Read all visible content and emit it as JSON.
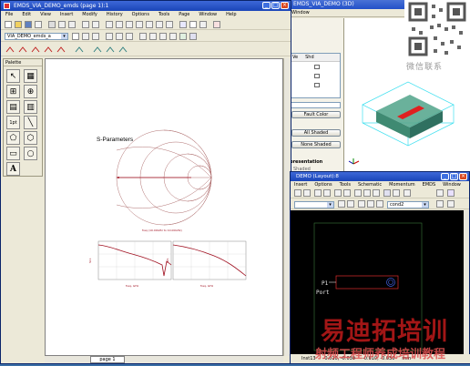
{
  "win3d": {
    "title": "EMDS_VIA_DEMO (3D)",
    "menu": "Window",
    "col_headers": [
      "Ve",
      "Shd"
    ],
    "buttons": [
      "Fault Color",
      "All Shaded",
      "None Shaded"
    ],
    "section_label": "presentation",
    "shaded_label": "Shaded"
  },
  "main": {
    "title": "EMDS_VIA_DEMO_emds (page 1):1",
    "menu": [
      "File",
      "Edit",
      "View",
      "Insert",
      "Modify",
      "History",
      "Options",
      "Tools",
      "Page",
      "Window",
      "Help"
    ],
    "design_combo": "VIA_DEMO_emds_a",
    "palette_title": "Palette",
    "palette_text_tool": "A",
    "palette_port_tool": "1pt",
    "page_tab": "page 1"
  },
  "chart": {
    "title": "S-Parameters",
    "smith_caption": "freq (10.00GHz to 10.00GHz)",
    "plot1_xlabel": "freq, GHz",
    "plot1_ylabel": "S11",
    "plot2_xlabel": "freq, GHz",
    "plot2_ylabel": "S21"
  },
  "layout": {
    "title": "DEMO (Layout):8",
    "menu": [
      "Insert",
      "Options",
      "Tools",
      "Schematic",
      "Momentum",
      "EMDS",
      "Window"
    ],
    "combo_value": "cond2",
    "p1_label": "P1",
    "port_label": "Port",
    "status": [
      "Inst13",
      "-0.010, -0.030",
      "-0.010, -0.030",
      "mm"
    ]
  },
  "watermark": {
    "label": "微信联系",
    "big_text": "易迪拓培训",
    "url_text": "射频工程师养成培训教程"
  },
  "colors": {
    "titlebar": "#2350c8",
    "chrome": "#ece9d8",
    "smith_grid": "#b07070",
    "trace": "#a01020"
  }
}
